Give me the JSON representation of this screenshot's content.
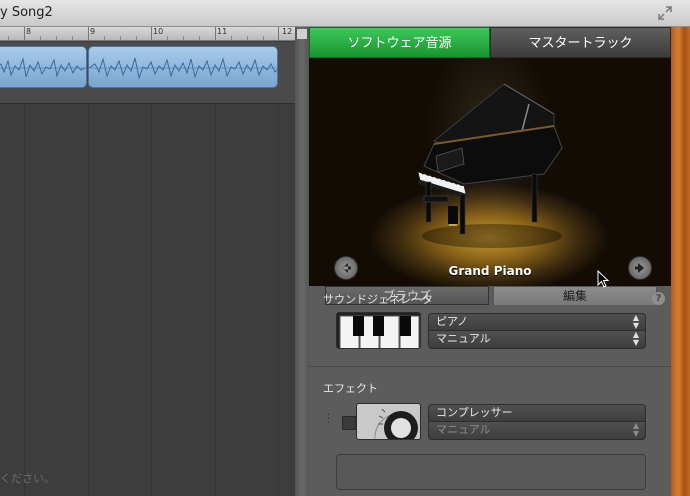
{
  "window": {
    "title": "y Song2"
  },
  "ruler": {
    "bars": [
      "8",
      "9",
      "10",
      "11",
      "12"
    ]
  },
  "track_area": {
    "hint_text": "ください。"
  },
  "inspector": {
    "tabs": [
      {
        "label": "ソフトウェア音源",
        "active": true
      },
      {
        "label": "マスタートラック",
        "active": false
      }
    ],
    "instrument_name": "Grand Piano",
    "subtabs": [
      {
        "label": "ブラウズ",
        "active": false
      },
      {
        "label": "編集",
        "active": true
      }
    ],
    "sound_generator": {
      "heading": "サウンドジェネレータ",
      "value": "ピアノ",
      "preset": "マニュアル"
    },
    "effects": {
      "heading": "エフェクト",
      "items": [
        {
          "value": "コンプレッサー",
          "preset": "マニュアル"
        }
      ]
    },
    "help": "?"
  },
  "colors": {
    "active_tab": "#19942f",
    "region": "#7aa5d0",
    "wood": "#c06a24"
  },
  "icons": {
    "prev": "left-arrow-icon",
    "next": "right-arrow-icon",
    "fullscreen": "fullscreen-icon",
    "help": "help-icon"
  }
}
